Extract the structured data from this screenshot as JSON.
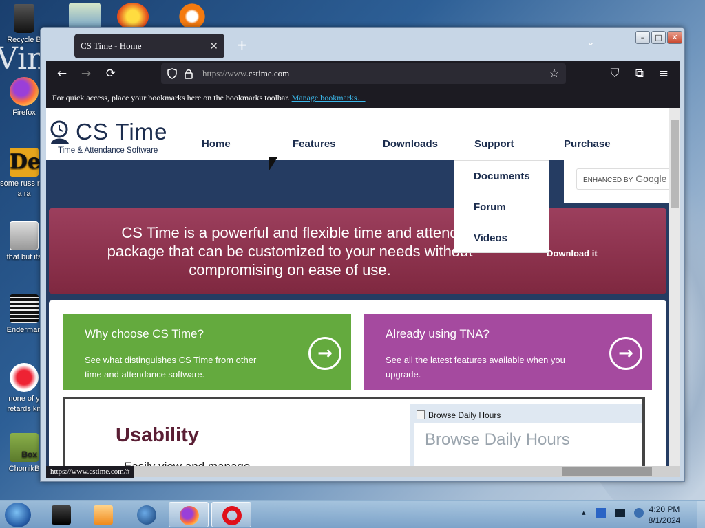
{
  "colors": {
    "accent_green": "#64aa3e",
    "accent_purple": "#a54a9f",
    "banner": "#8e3350",
    "navy": "#1c2d4e",
    "browser_dark": "#1c1b22"
  },
  "desktop": {
    "watermark": "Vind",
    "icons": [
      {
        "name": "recycle-bin-icon",
        "label": "Recycle B"
      },
      {
        "name": "firefox-desktop-icon",
        "label": "Firefox"
      },
      {
        "name": "russian-app-icon",
        "label": "some russ ran a ra"
      },
      {
        "name": "that-but-icon",
        "label": "that but its"
      },
      {
        "name": "enderman-icon",
        "label": "Enderman"
      },
      {
        "name": "retards-icon",
        "label": "none of y retards kn"
      },
      {
        "name": "chomikbox-icon",
        "label": "ChomikB"
      }
    ],
    "chomik_label": "Box"
  },
  "browser": {
    "tab_title": "CS Time - Home",
    "tab_close": "✕",
    "new_tab": "+",
    "tab_list": "⌄",
    "window_buttons": {
      "min": "–",
      "max": "□",
      "close": "✕"
    },
    "nav": {
      "back": "←",
      "forward": "→",
      "reload": "⟳",
      "star": "☆",
      "pocket": "⛉",
      "extensions": "⧉",
      "menu": "≡"
    },
    "url_prefix": "https://www.",
    "url_host": "cstime.com",
    "bookmarks_text": "For quick access, place your bookmarks here on the bookmarks toolbar.",
    "bookmarks_link": "Manage bookmarks…",
    "status_url": "https://www.cstime.com/#"
  },
  "site": {
    "logo": {
      "big": "CS Time",
      "small": "Time & Attendance Software"
    },
    "menu": [
      "Home",
      "Features",
      "Downloads",
      "Support",
      "Purchase"
    ],
    "support_dropdown": [
      "Documents",
      "Forum",
      "Videos"
    ],
    "search_placeholder_prefix": "ENHANCED BY",
    "search_brand": "Google",
    "banner": {
      "text": "CS Time is a powerful and flexible time and attend package that can be customized to your needs without compromising on ease of use.",
      "download": "Download it"
    },
    "cards": [
      {
        "title": "Why choose CS Time?",
        "body": "See what distinguishes CS Time from other time and attendance software.",
        "arrow": "→"
      },
      {
        "title": "Already using TNA?",
        "body": "See all the latest features available when you upgrade.",
        "arrow": "→"
      }
    ],
    "usability": {
      "title": "Usability",
      "subtitle": "Easily view and manage"
    },
    "screenshot": {
      "window_title": "Browse Daily Hours",
      "heading": "Browse Daily Hours"
    }
  },
  "taskbar": {
    "tray": "▴",
    "time": "4:20 PM",
    "date": "8/1/2024"
  }
}
